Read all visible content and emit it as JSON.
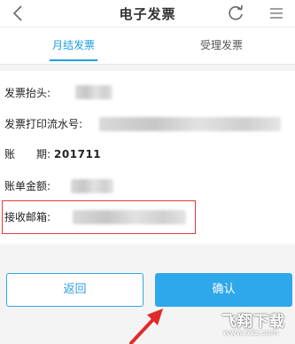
{
  "nav": {
    "title": "电子发票",
    "back_icon": "chevron-left-icon",
    "refresh_icon": "refresh-icon",
    "menu_icon": "menu-icon"
  },
  "tabs": [
    {
      "label": "月结发票",
      "active": true
    },
    {
      "label": "受理发票",
      "active": false
    }
  ],
  "fields": {
    "invoice_title_label": "发票抬头:",
    "serial_label": "发票打印流水号:",
    "period_label": "账　　期:",
    "period_value": "201711",
    "amount_label": "账单金额:",
    "email_label": "接收邮箱:"
  },
  "buttons": {
    "back_label": "返回",
    "confirm_label": "确认"
  },
  "colors": {
    "accent": "#1c9fe3",
    "confirm_bg": "#2ea8ea",
    "highlight": "#e23a3a"
  },
  "watermark": {
    "main": "飞翔下载",
    "sub": "www.52z.com"
  }
}
